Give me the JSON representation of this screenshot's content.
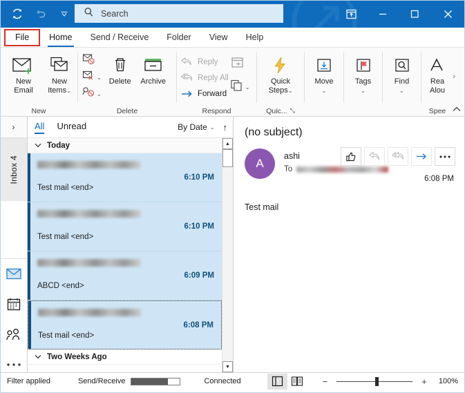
{
  "titlebar": {
    "quick_access": [
      {
        "name": "send-receive-all",
        "icon": "refresh-icon"
      },
      {
        "name": "undo",
        "icon": "undo-icon"
      },
      {
        "name": "customize-quick-access-toolbar",
        "icon": "chevron-down-icon"
      }
    ],
    "search": {
      "placeholder": "Search",
      "value": "Search",
      "icon": "search-icon"
    },
    "window_controls": [
      {
        "name": "ribbon-display-options",
        "icon": "ribbon-options-icon",
        "glyph": "⬜"
      },
      {
        "name": "minimize",
        "icon": "minimize-icon",
        "glyph": "–"
      },
      {
        "name": "maximize",
        "icon": "maximize-icon",
        "glyph": "□"
      },
      {
        "name": "close",
        "icon": "close-icon",
        "glyph": "✕"
      }
    ],
    "watermark": "(↗)",
    "accent_color": "#0f6cbd"
  },
  "tabs": [
    {
      "label": "File",
      "active": false,
      "highlighted": true
    },
    {
      "label": "Home",
      "active": true
    },
    {
      "label": "Send / Receive",
      "active": false
    },
    {
      "label": "Folder",
      "active": false
    },
    {
      "label": "View",
      "active": false
    },
    {
      "label": "Help",
      "active": false
    }
  ],
  "ribbon": {
    "groups": [
      {
        "label": "New",
        "buttons": [
          {
            "label_line1": "New",
            "label_line2": "Email",
            "icon": "new-email-icon"
          },
          {
            "label_line1": "New",
            "label_line2": "Items",
            "icon": "new-items-icon",
            "caret": "⌄"
          }
        ]
      },
      {
        "label": "Delete",
        "small_buttons": [
          {
            "name": "ignore",
            "icon": "ignore-icon"
          },
          {
            "name": "clean-up",
            "icon": "clean-up-icon",
            "caret": "⌄"
          },
          {
            "name": "junk",
            "icon": "junk-icon",
            "caret": "⌄"
          }
        ],
        "buttons": [
          {
            "label_line1": "Delete",
            "label_line2": "",
            "icon": "trash-icon"
          },
          {
            "label_line1": "Archive",
            "label_line2": "",
            "icon": "archive-icon"
          }
        ]
      },
      {
        "label": "Respond",
        "respond_buttons": [
          {
            "label": "Reply",
            "icon": "reply-icon",
            "enabled": false
          },
          {
            "label": "Reply All",
            "icon": "reply-all-icon",
            "enabled": false
          },
          {
            "label": "Forward",
            "icon": "forward-icon",
            "enabled": true
          }
        ],
        "extra_icons": [
          {
            "name": "meeting-icon"
          },
          {
            "name": "more-respond-icon",
            "caret": "⌄"
          }
        ]
      },
      {
        "label": "Quic...",
        "dialog_launcher": "⤡",
        "buttons": [
          {
            "label_line1": "Quick",
            "label_line2": "Steps",
            "icon": "quick-steps-icon",
            "caret": "⌄"
          }
        ]
      },
      {
        "label": "",
        "buttons": [
          {
            "label_line1": "Move",
            "label_line2": "",
            "icon": "move-icon",
            "caret": "⌄"
          }
        ]
      },
      {
        "label": "",
        "buttons": [
          {
            "label_line1": "Tags",
            "label_line2": "",
            "icon": "tags-icon",
            "caret": "⌄"
          }
        ]
      },
      {
        "label": "",
        "buttons": [
          {
            "label_line1": "Find",
            "label_line2": "",
            "icon": "find-icon",
            "caret": "⌄"
          }
        ]
      },
      {
        "label": "Spee",
        "buttons": [
          {
            "label_line1": "Rea",
            "label_line2": "Alou",
            "icon": "read-aloud-icon"
          }
        ]
      }
    ],
    "collapse_icon": "chevron-up-icon",
    "overflow_icon": "chevron-right-icon"
  },
  "rail": {
    "expand_icon": "chevron-right-icon",
    "inbox_label": "Inbox 4",
    "icons": [
      {
        "name": "mail-icon",
        "active": true
      },
      {
        "name": "calendar-icon",
        "active": false
      },
      {
        "name": "people-icon",
        "active": false
      },
      {
        "name": "more-apps-icon",
        "active": false
      }
    ]
  },
  "message_list": {
    "filters": [
      {
        "label": "All",
        "active": true
      },
      {
        "label": "Unread",
        "active": false
      }
    ],
    "sort": {
      "label": "By Date",
      "caret": "⌄"
    },
    "sort_direction_icon": "arrow-up-icon",
    "groups": [
      {
        "label": "Today",
        "expanded": true,
        "messages": [
          {
            "sender": "",
            "subject": "Test mail  <end>",
            "time": "6:10 PM",
            "selected": true,
            "focused": false
          },
          {
            "sender": "",
            "subject": "Test mail  <end>",
            "time": "6:10 PM",
            "selected": true,
            "focused": false
          },
          {
            "sender": "",
            "subject": "ABCD <end>",
            "time": "6:09 PM",
            "selected": true,
            "focused": false
          },
          {
            "sender": "",
            "subject": "Test mail  <end>",
            "time": "6:08 PM",
            "selected": true,
            "focused": true
          }
        ]
      },
      {
        "label": "Two Weeks Ago",
        "expanded": true,
        "messages": []
      }
    ],
    "scrollbar": {
      "up_icon": "▲",
      "down_icon": "▼"
    }
  },
  "reading_pane": {
    "subject": "(no subject)",
    "avatar_initial": "A",
    "avatar_color": "#8b56b0",
    "sender": "ashi",
    "to_label": "To",
    "time": "6:08 PM",
    "body": "Test mail",
    "actions": [
      {
        "name": "like-button",
        "icon": "thumbs-up-icon",
        "enabled": true
      },
      {
        "name": "reply-button",
        "icon": "reply-icon",
        "enabled": false
      },
      {
        "name": "reply-all-button",
        "icon": "reply-all-icon",
        "enabled": false
      },
      {
        "name": "forward-button",
        "icon": "forward-icon",
        "enabled": true
      },
      {
        "name": "more-actions-button",
        "icon": "ellipsis-icon",
        "enabled": true
      }
    ]
  },
  "status_bar": {
    "filter": "Filter applied",
    "send_receive_label": "Send/Receive",
    "progress_percent": 75,
    "connection": "Connected",
    "view_buttons": [
      {
        "name": "normal-view-button",
        "icon": "normal-view-icon",
        "selected": true
      },
      {
        "name": "reading-view-button",
        "icon": "reading-view-icon",
        "selected": false
      }
    ],
    "zoom_out": "−",
    "zoom_in": "+",
    "zoom_level": "100%"
  }
}
